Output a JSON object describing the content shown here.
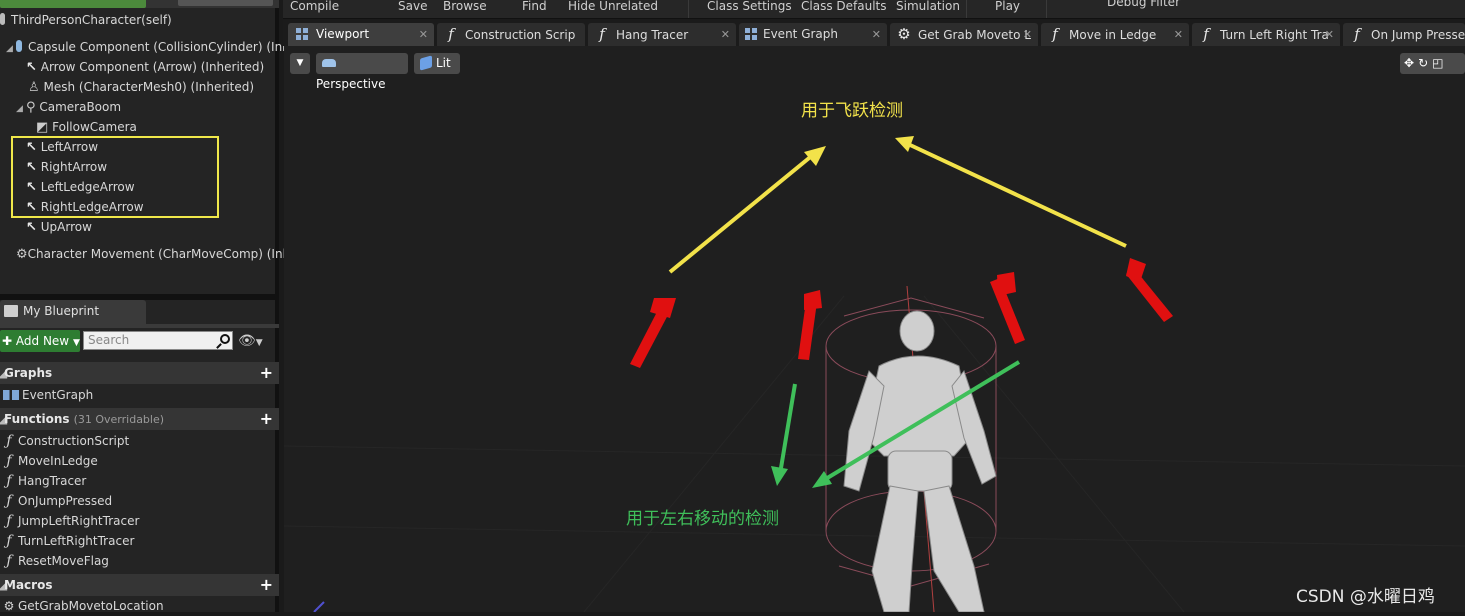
{
  "components": {
    "root": "ThirdPersonCharacter(self)",
    "items": [
      {
        "label": "Capsule Component (CollisionCylinder) (Inhe"
      },
      {
        "label": "Arrow Component (Arrow) (Inherited)"
      },
      {
        "label": "Mesh (CharacterMesh0) (Inherited)"
      },
      {
        "label": "CameraBoom"
      },
      {
        "label": "FollowCamera"
      },
      {
        "label": "LeftArrow"
      },
      {
        "label": "RightArrow"
      },
      {
        "label": "LeftLedgeArrow"
      },
      {
        "label": "RightLedgeArrow"
      },
      {
        "label": "UpArrow"
      },
      {
        "label": "Character Movement (CharMoveComp) (Inhe"
      }
    ]
  },
  "my_blueprint": {
    "tab_label": "My Blueprint",
    "add_new": "Add New",
    "search_placeholder": "Search",
    "graphs_label": "Graphs",
    "graphs": [
      "EventGraph"
    ],
    "functions_label": "Functions",
    "functions_note": "(31 Overridable)",
    "functions": [
      "ConstructionScript",
      "MoveInLedge",
      "HangTracer",
      "OnJumpPressed",
      "JumpLeftRightTracer",
      "TurnLeftRightTracer",
      "ResetMoveFlag"
    ],
    "macros_label": "Macros",
    "macros": [
      "GetGrabMovetoLocation"
    ]
  },
  "toolbar": {
    "items": [
      "Compile",
      "Save",
      "Browse",
      "Find",
      "Hide Unrelated",
      "Class Settings",
      "Class Defaults",
      "Simulation",
      "Play",
      "Debug Filter"
    ]
  },
  "tabs": [
    {
      "label": "Viewport",
      "icon": "grid-icon"
    },
    {
      "label": "Construction Scrip",
      "icon": "function-icon"
    },
    {
      "label": "Hang Tracer",
      "icon": "function-icon"
    },
    {
      "label": "Event Graph",
      "icon": "grid-icon"
    },
    {
      "label": "Get Grab Moveto L",
      "icon": "gear-icon"
    },
    {
      "label": "Move in Ledge",
      "icon": "function-icon"
    },
    {
      "label": "Turn Left Right Tra",
      "icon": "function-icon"
    },
    {
      "label": "On Jump Pressed",
      "icon": "function-icon"
    }
  ],
  "viewport": {
    "perspective": "Perspective",
    "lit": "Lit",
    "annotation_top": "用于飞跃检测",
    "annotation_bottom": "用于左右移动的检测",
    "watermark": "CSDN @水曜日鸡",
    "colors": {
      "yellow": "#f2e24a",
      "green": "#3fbf5a",
      "red": "#e01010"
    }
  }
}
